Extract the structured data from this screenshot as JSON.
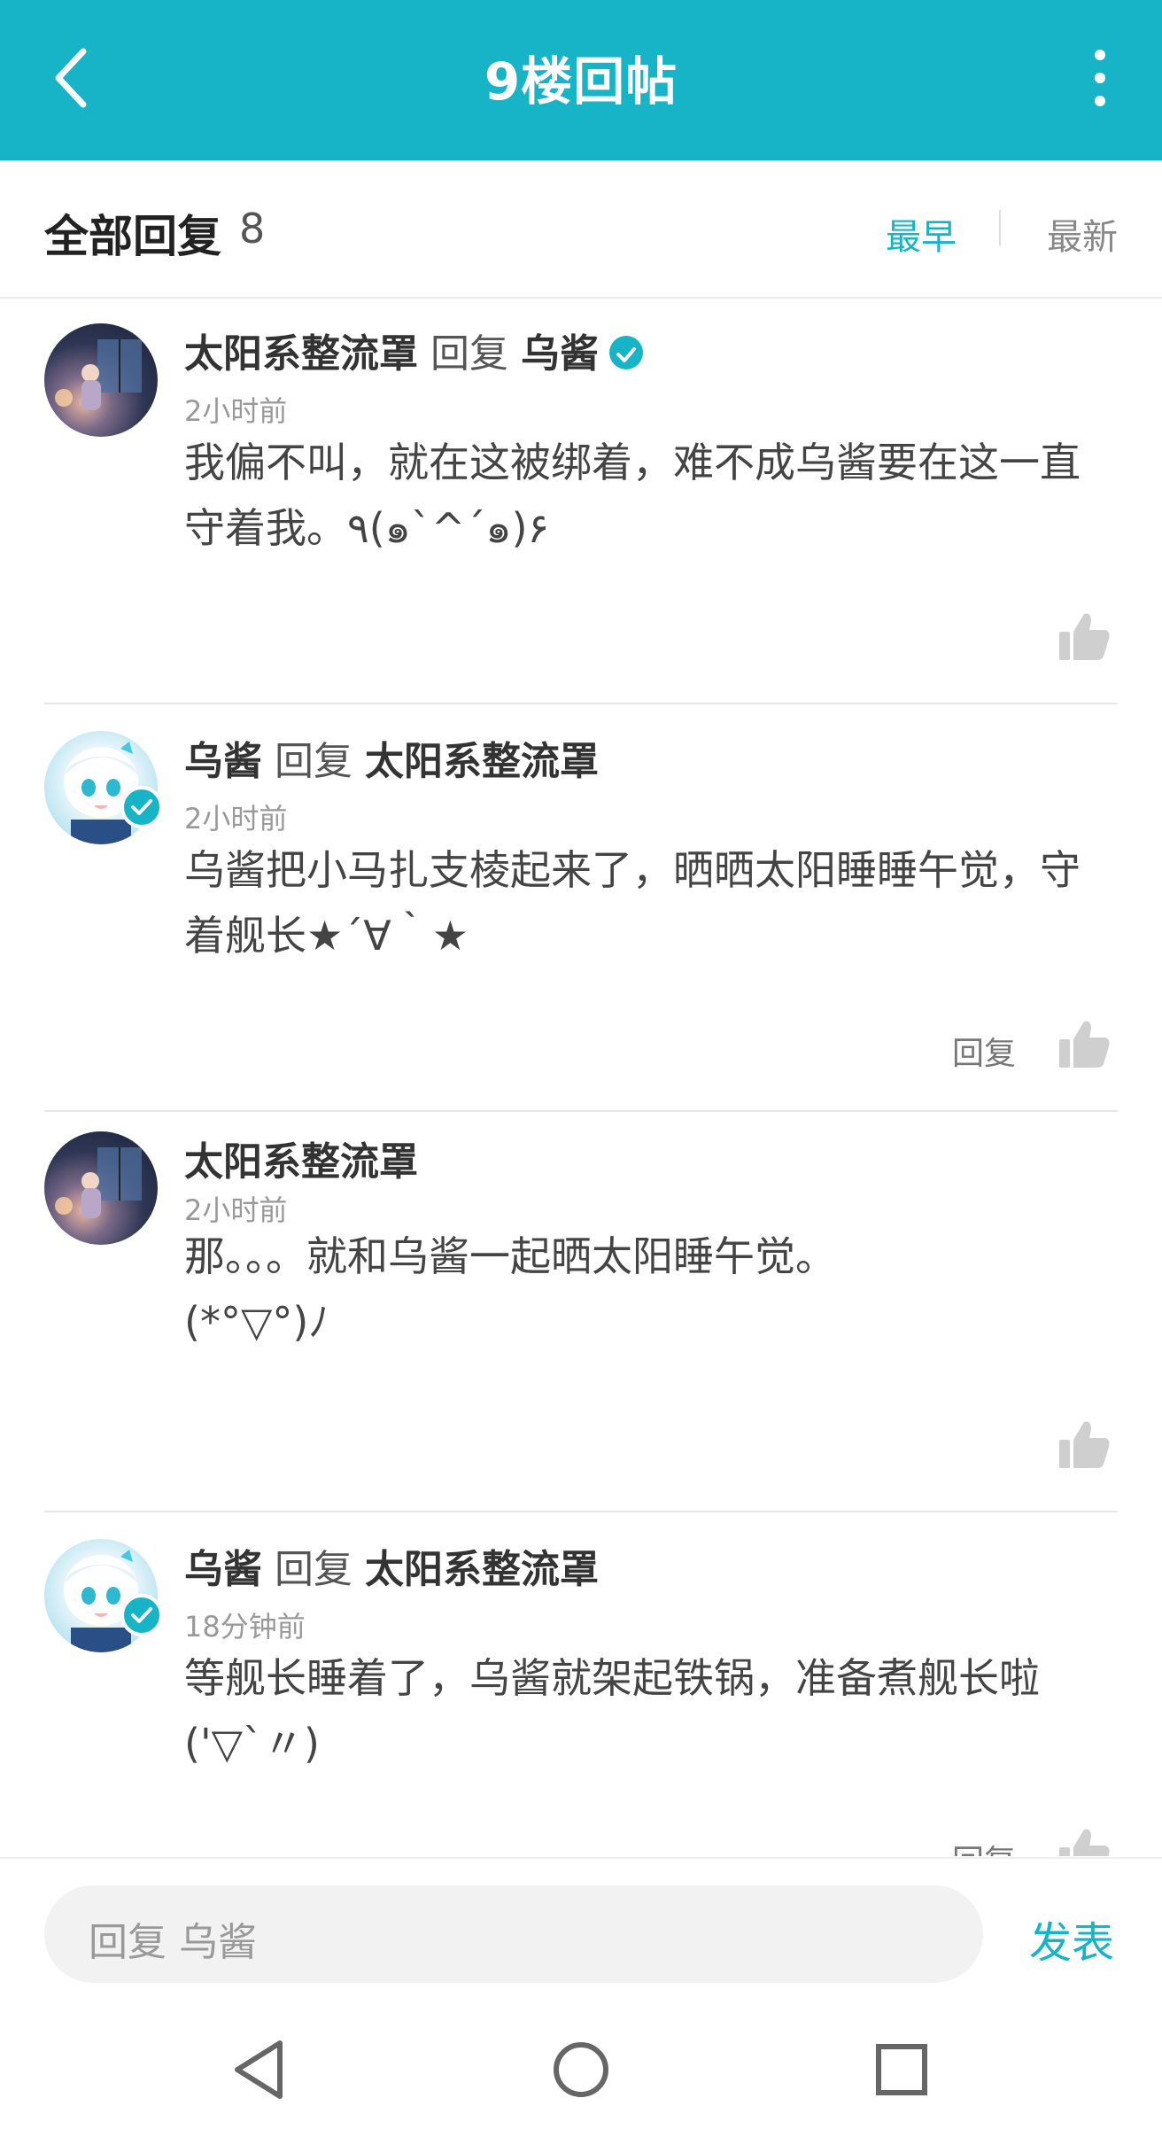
{
  "header": {
    "title": "9楼回帖"
  },
  "subhead": {
    "label": "全部回复",
    "count": "8",
    "sort_early": "最早",
    "sort_new": "最新"
  },
  "colors": {
    "accent": "#17b4c7",
    "text": "#333333",
    "muted": "#999999"
  },
  "replies": [
    {
      "author": "太阳系整流罩",
      "reply_word": "回复",
      "target": "乌酱",
      "time": "2小时前",
      "lines": [
        "我偏不叫，就在这被绑着，难不成乌酱要在这一直",
        "守着我。٩(๑`^´๑)۶"
      ],
      "reply_label": ""
    },
    {
      "author": "乌酱",
      "reply_word": "回复",
      "target": "太阳系整流罩",
      "time": "2小时前",
      "lines": [
        "乌酱把小马扎支棱起来了，晒晒太阳睡睡午觉，守",
        "着舰长★´∀｀★"
      ],
      "reply_label": "回复"
    },
    {
      "author": "太阳系整流罩",
      "reply_word": "",
      "target": "",
      "time": "2小时前",
      "lines": [
        "那。。。就和乌酱一起晒太阳睡午觉。",
        " (*°▽°)ﾉ"
      ],
      "reply_label": ""
    },
    {
      "author": "乌酱",
      "reply_word": "回复",
      "target": "太阳系整流罩",
      "time": "18分钟前",
      "lines": [
        "等舰长睡着了，乌酱就架起铁锅，准备煮舰长啦",
        "('▽`〃)"
      ],
      "reply_label": "回复"
    }
  ],
  "composer": {
    "placeholder": "回复 乌酱",
    "send_label": "发表"
  },
  "icons": {
    "back": "chevron-left-icon",
    "more": "more-vertical-icon",
    "like": "thumbs-up-icon",
    "verified": "verified-check-icon",
    "nav_back": "triangle-back-icon",
    "nav_home": "circle-home-icon",
    "nav_recent": "square-recent-icon"
  }
}
